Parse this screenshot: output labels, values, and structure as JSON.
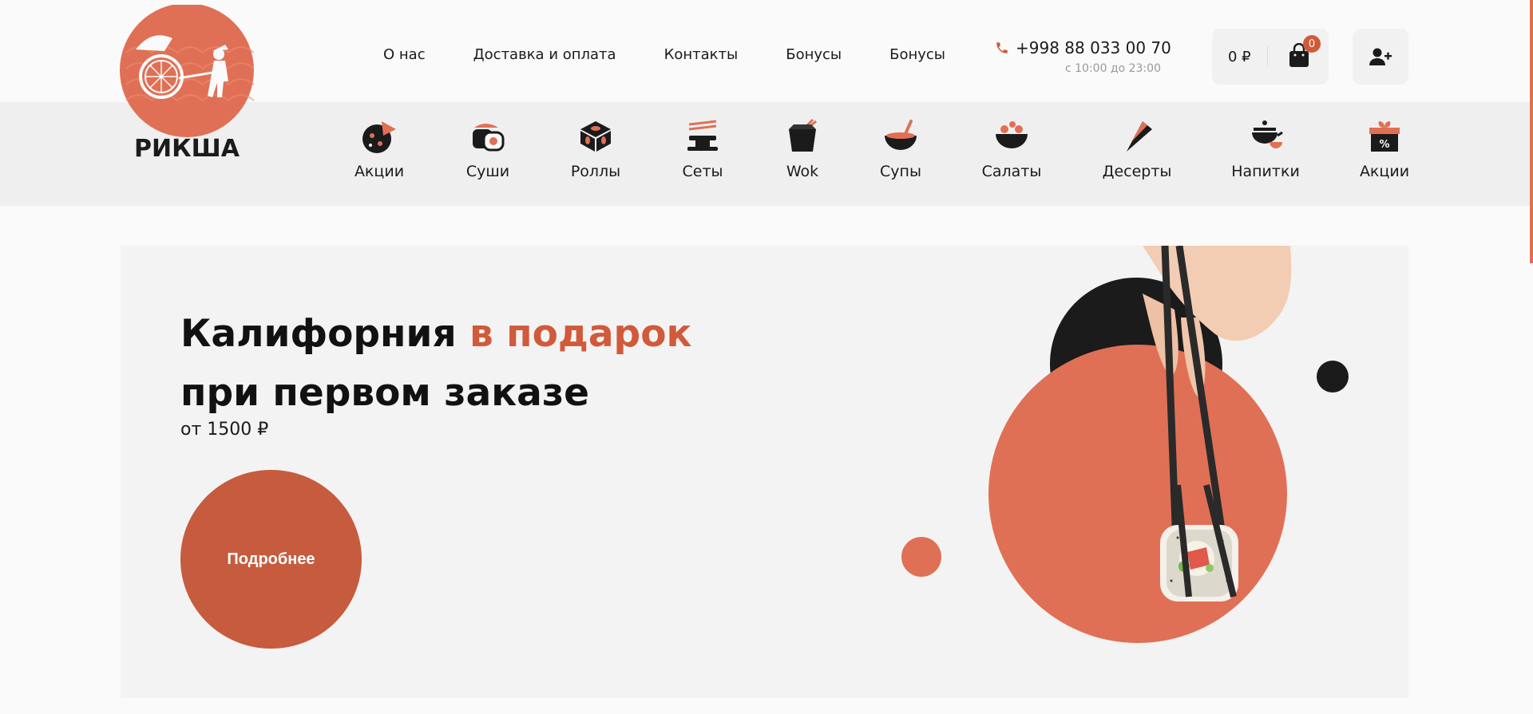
{
  "logo": {
    "brand_text": "РИКША"
  },
  "top_nav": {
    "items": [
      "О нас",
      "Доставка и оплата",
      "Контакты",
      "Бонусы",
      "Бонусы"
    ]
  },
  "contact": {
    "phone": "+998 88 033 00 70",
    "hours": "с 10:00 до 23:00",
    "phone_icon": "phone-icon"
  },
  "cart": {
    "total": "0 ₽",
    "count": "0",
    "icon": "shopping-bag-icon"
  },
  "user": {
    "icon": "add-user-icon"
  },
  "categories": [
    {
      "label": "Акции",
      "icon": "pizza-icon"
    },
    {
      "label": "Суши",
      "icon": "sushi-icon"
    },
    {
      "label": "Роллы",
      "icon": "rolls-icon"
    },
    {
      "label": "Сеты",
      "icon": "sets-icon"
    },
    {
      "label": "Wok",
      "icon": "wok-box-icon"
    },
    {
      "label": "Супы",
      "icon": "soup-bowl-icon"
    },
    {
      "label": "Салаты",
      "icon": "salad-bowl-icon"
    },
    {
      "label": "Десерты",
      "icon": "dessert-icon"
    },
    {
      "label": "Напитки",
      "icon": "teapot-icon"
    },
    {
      "label": "Акции",
      "icon": "gift-percent-icon"
    }
  ],
  "hero": {
    "title_part1": "Калифорния ",
    "title_accent": "в подарок",
    "title_line2": "при первом заказе",
    "subtitle": "от 1500 ₽",
    "button_label": "Подробнее"
  },
  "colors": {
    "accent": "#d05a3a",
    "accent_light": "#e07055",
    "dark": "#1b1b1b",
    "catbar_bg": "#efefef",
    "hero_bg": "#f3f3f3"
  }
}
